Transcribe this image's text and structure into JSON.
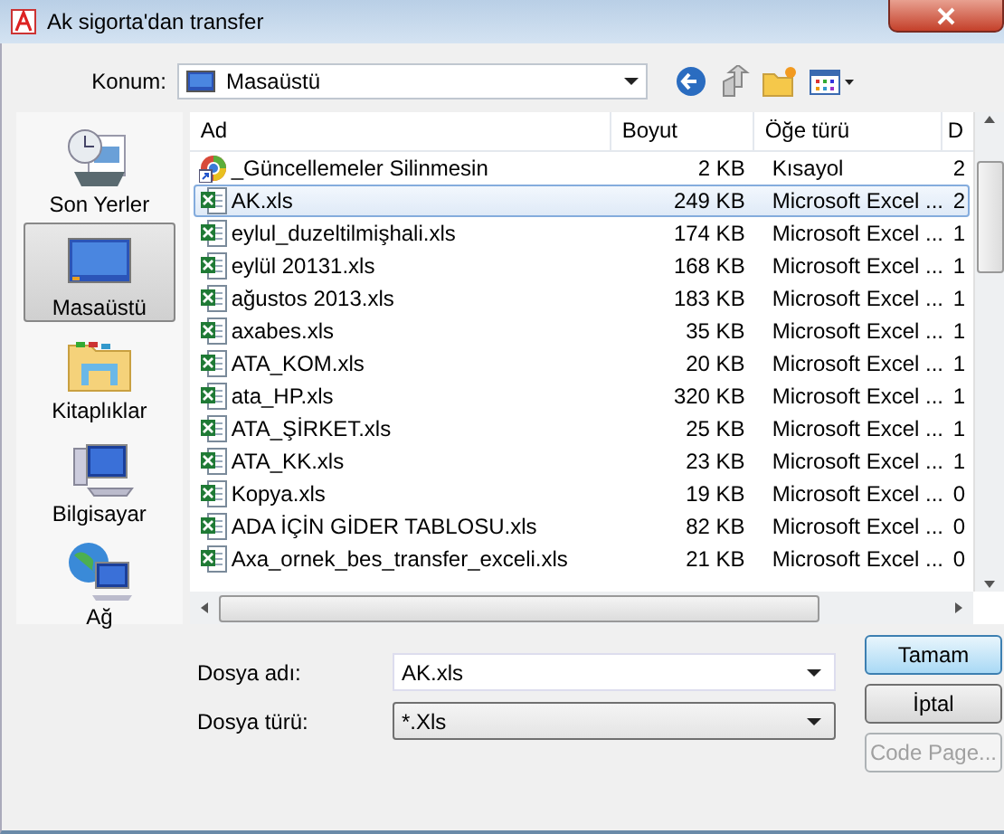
{
  "window": {
    "title": "Ak sigorta'dan transfer"
  },
  "location": {
    "label": "Konum:",
    "value": "Masaüstü"
  },
  "places": [
    {
      "label": "Son Yerler",
      "kind": "recent",
      "selected": false
    },
    {
      "label": "Masaüstü",
      "kind": "desktop",
      "selected": true
    },
    {
      "label": "Kitaplıklar",
      "kind": "libraries",
      "selected": false
    },
    {
      "label": "Bilgisayar",
      "kind": "computer",
      "selected": false
    },
    {
      "label": "Ağ",
      "kind": "network",
      "selected": false
    }
  ],
  "file_list": {
    "columns": [
      "Ad",
      "Boyut",
      "Öğe türü",
      "D"
    ],
    "rows": [
      {
        "name": "_Güncellemeler Silinmesin",
        "size": "2 KB",
        "type": "Kısayol",
        "column_4": "2",
        "kind": "shortcut",
        "selected": false
      },
      {
        "name": "AK.xls",
        "size": "249 KB",
        "type": "Microsoft Excel ...",
        "column_4": "2",
        "kind": "excel",
        "selected": true
      },
      {
        "name": "eylul_duzeltilmişhali.xls",
        "size": "174 KB",
        "type": "Microsoft Excel ...",
        "column_4": "1",
        "kind": "excel",
        "selected": false
      },
      {
        "name": "eylül 20131.xls",
        "size": "168 KB",
        "type": "Microsoft Excel ...",
        "column_4": "1",
        "kind": "excel",
        "selected": false
      },
      {
        "name": "ağustos 2013.xls",
        "size": "183 KB",
        "type": "Microsoft Excel ...",
        "column_4": "1",
        "kind": "excel",
        "selected": false
      },
      {
        "name": "axabes.xls",
        "size": "35 KB",
        "type": "Microsoft Excel ...",
        "column_4": "1",
        "kind": "excel",
        "selected": false
      },
      {
        "name": "ATA_KOM.xls",
        "size": "20 KB",
        "type": "Microsoft Excel ...",
        "column_4": "1",
        "kind": "excel",
        "selected": false
      },
      {
        "name": "ata_HP.xls",
        "size": "320 KB",
        "type": "Microsoft Excel ...",
        "column_4": "1",
        "kind": "excel",
        "selected": false
      },
      {
        "name": "ATA_ŞİRKET.xls",
        "size": "25 KB",
        "type": "Microsoft Excel ...",
        "column_4": "1",
        "kind": "excel",
        "selected": false
      },
      {
        "name": "ATA_KK.xls",
        "size": "23 KB",
        "type": "Microsoft Excel ...",
        "column_4": "1",
        "kind": "excel",
        "selected": false
      },
      {
        "name": "Kopya.xls",
        "size": "19 KB",
        "type": "Microsoft Excel ...",
        "column_4": "0",
        "kind": "excel",
        "selected": false
      },
      {
        "name": "ADA İÇİN GİDER TABLOSU.xls",
        "size": "82 KB",
        "type": "Microsoft Excel ...",
        "column_4": "0",
        "kind": "excel",
        "selected": false
      },
      {
        "name": "Axa_ornek_bes_transfer_exceli.xls",
        "size": "21 KB",
        "type": "Microsoft Excel ...",
        "column_4": "0",
        "kind": "excel",
        "selected": false
      }
    ]
  },
  "file_name": {
    "label": "Dosya adı:",
    "value": "AK.xls"
  },
  "file_type": {
    "label": "Dosya türü:",
    "value": "*.Xls"
  },
  "buttons": [
    {
      "label": "Tamam",
      "default": true,
      "disabled": false
    },
    {
      "label": "İptal",
      "default": false,
      "disabled": false
    },
    {
      "label": "Code Page...",
      "default": false,
      "disabled": true
    }
  ]
}
